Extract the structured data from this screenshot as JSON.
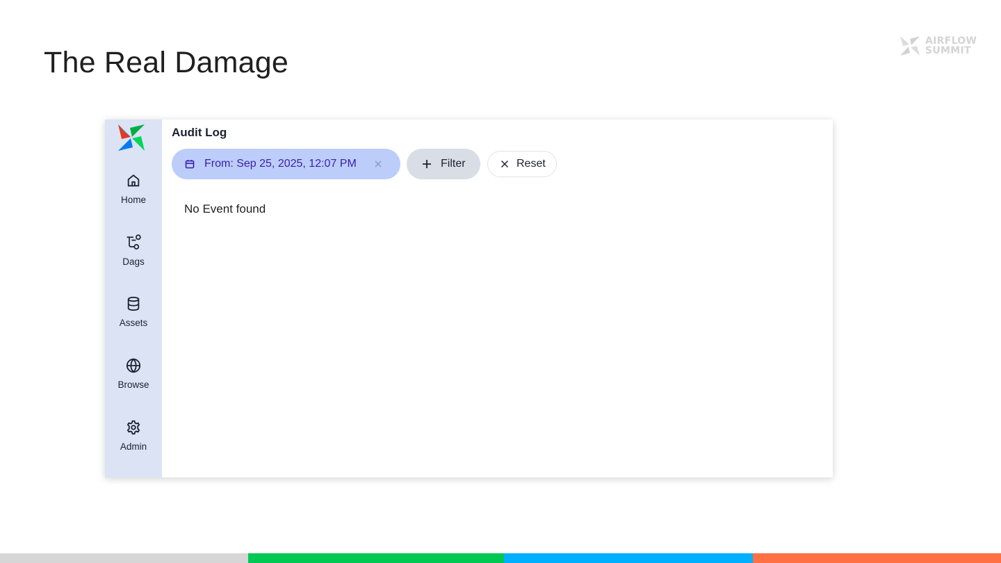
{
  "slide": {
    "title": "The Real Damage",
    "brand": {
      "line1": "AIRFLOW",
      "line2": "SUMMIT"
    }
  },
  "sidebar": {
    "items": [
      {
        "label": "Home",
        "icon": "home-icon"
      },
      {
        "label": "Dags",
        "icon": "dag-icon"
      },
      {
        "label": "Assets",
        "icon": "database-icon"
      },
      {
        "label": "Browse",
        "icon": "globe-icon"
      },
      {
        "label": "Admin",
        "icon": "gear-icon"
      }
    ]
  },
  "main": {
    "heading": "Audit Log",
    "date_filter": {
      "label": "From: Sep 25, 2025, 12:07 PM",
      "icon": "calendar-icon"
    },
    "filter_button": {
      "label": "Filter",
      "icon": "plus-icon"
    },
    "reset_button": {
      "label": "Reset",
      "icon": "close-icon"
    },
    "empty_message": "No Event found"
  },
  "colors": {
    "sidebar_bg": "#dbe3f5",
    "date_chip_bg": "#bccdfa",
    "date_chip_text": "#3a1fa8",
    "filter_bg": "#d9dde5",
    "bottom_bar": [
      "#d6d6d6",
      "#00c853",
      "#00b0ff",
      "#ff7043"
    ]
  }
}
